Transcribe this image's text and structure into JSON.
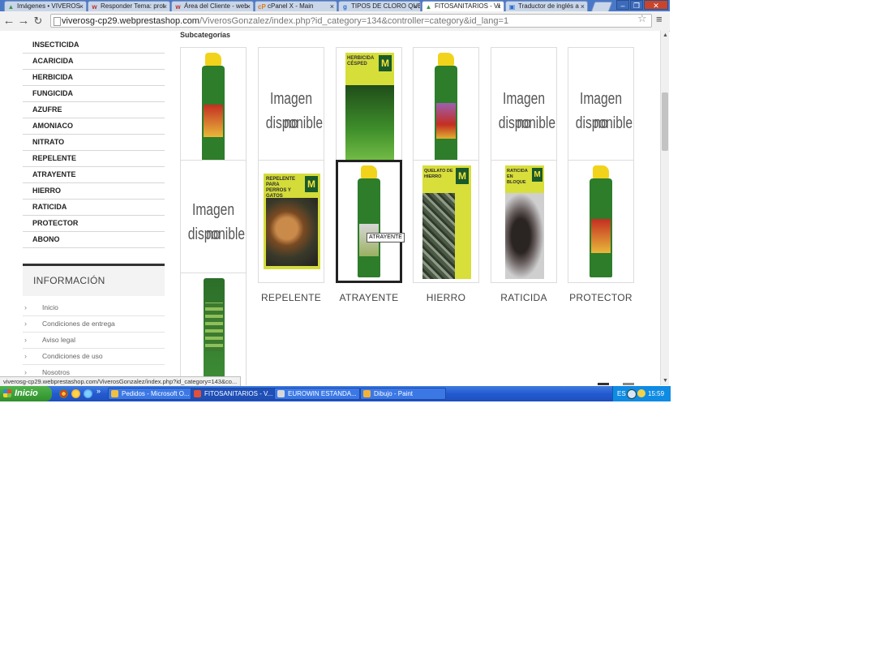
{
  "browser": {
    "tabs": [
      {
        "title": "Imágenes • VIVEROS",
        "favicon": "leaf-icon",
        "active": false
      },
      {
        "title": "Responder Tema: prot",
        "favicon": "w-logo-icon",
        "active": false
      },
      {
        "title": "Área del Cliente - web",
        "favicon": "w-logo-icon",
        "active": false
      },
      {
        "title": "cPanel X - Main",
        "favicon": "cpanel-icon",
        "active": false
      },
      {
        "title": "TIPOS DE CLORO QUE",
        "favicon": "google-icon",
        "active": false
      },
      {
        "title": "FITOSANITARIOS - VI",
        "favicon": "leaf-icon",
        "active": true
      },
      {
        "title": "Traductor de inglés a",
        "favicon": "translate-icon",
        "active": false
      }
    ],
    "tab_close": "×",
    "url_host": "viverosg-cp29.webprestashop.com",
    "url_rest": "/ViverosGonzalez/index.php?id_category=134&controller=category&id_lang=1",
    "status_url": "viverosg-cp29.webprestashop.com/ViverosGonzalez/index.php?id_category=143&co..."
  },
  "sidebar": {
    "categories": [
      "INSECTICIDA",
      "ACARICIDA",
      "HERBICIDA",
      "FUNGICIDA",
      "AZUFRE",
      "AMONIACO",
      "NITRATO",
      "REPELENTE",
      "ATRAYENTE",
      "HIERRO",
      "RATICIDA",
      "PROTECTOR",
      "ABONO"
    ],
    "info_title": "INFORMACIÓN",
    "info_links": [
      "Inicio",
      "Condiciones de entrega",
      "Aviso legal",
      "Condiciones de uso",
      "Nosotros"
    ]
  },
  "main": {
    "subcategories_title": "Subcategorías",
    "no_image_line1": "Imagen no",
    "no_image_line2": "disponible",
    "row2_labels": [
      "REPELENTE",
      "ATRAYENTE",
      "HIERRO",
      "RATICIDA",
      "PROTECTOR"
    ],
    "tooltip": "ATRAYENTE",
    "box_texts": {
      "herbicida": "HERBICIDA CÉSPED",
      "repelente": "REPELENTE PARA PERROS Y GATOS",
      "hierro": "QUELATO DE HIERRO",
      "raticida": "RATICIDA EN BLOQUE",
      "brand": "MASSO GARDEN"
    }
  },
  "taskbar": {
    "start_label": "Inicio",
    "tasks": [
      {
        "label": "Pedidos - Microsoft O...",
        "icon_color": "#f0c040",
        "active": false
      },
      {
        "label": "FITOSANITARIOS - V...",
        "icon_color": "#e0503a",
        "active": true
      },
      {
        "label": "EUROWIN ESTANDA...",
        "icon_color": "#d8d8d8",
        "active": false
      },
      {
        "label": "Dibujo - Paint",
        "icon_color": "#f2b23a",
        "active": false
      }
    ],
    "language": "ES",
    "clock": "15:59"
  }
}
